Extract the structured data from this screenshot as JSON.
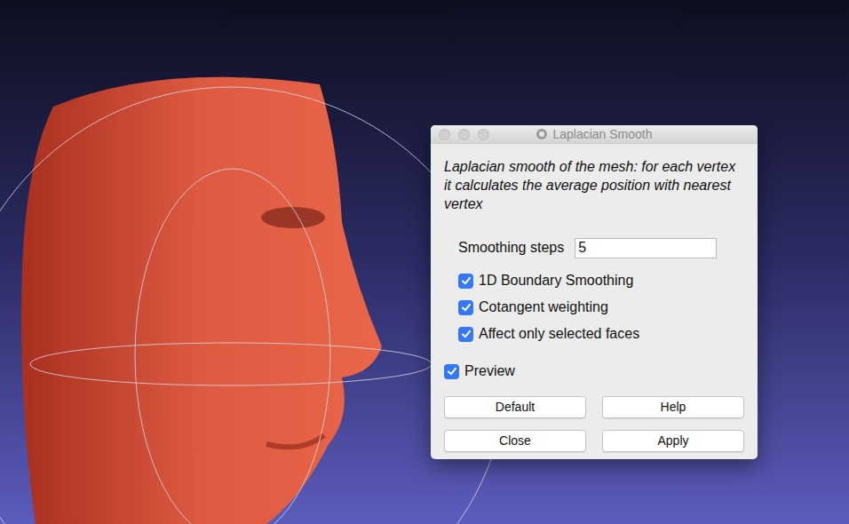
{
  "window": {
    "title": "Laplacian Smooth",
    "controls": [
      "close",
      "minimize",
      "zoom"
    ]
  },
  "description": "Laplacian smooth of the mesh: for each vertex it calculates the average position with nearest vertex",
  "fields": [
    {
      "label": "Smoothing steps",
      "value": "5"
    }
  ],
  "options": [
    {
      "label": "1D Boundary Smoothing",
      "checked": true
    },
    {
      "label": "Cotangent weighting",
      "checked": true
    },
    {
      "label": "Affect only selected faces",
      "checked": true
    }
  ],
  "preview": {
    "label": "Preview",
    "checked": true
  },
  "buttons": [
    "Default",
    "Help",
    "Close",
    "Apply"
  ]
}
